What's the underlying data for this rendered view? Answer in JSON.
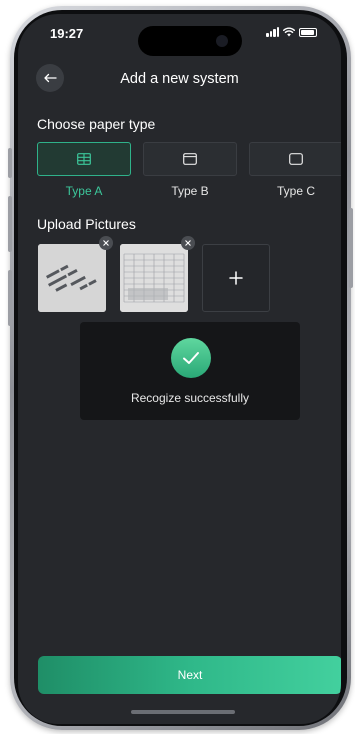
{
  "status_bar": {
    "time": "19:27"
  },
  "header": {
    "title": "Add a new system",
    "back_icon": "arrow-left-icon"
  },
  "paper_type": {
    "title": "Choose paper type",
    "options": [
      {
        "label": "Type A",
        "icon": "grid-table-icon",
        "selected": true
      },
      {
        "label": "Type B",
        "icon": "window-frame-icon",
        "selected": false
      },
      {
        "label": "Type C",
        "icon": "square-icon",
        "selected": false
      }
    ]
  },
  "upload": {
    "title": "Upload Pictures",
    "add_icon": "plus-icon",
    "remove_icon": "close-icon"
  },
  "toast": {
    "message": "Recogize successfully",
    "icon": "check-icon"
  },
  "footer": {
    "next_label": "Next"
  },
  "colors": {
    "accent": "#3cc79b",
    "background": "#26282c",
    "toast_bg": "#151618"
  }
}
